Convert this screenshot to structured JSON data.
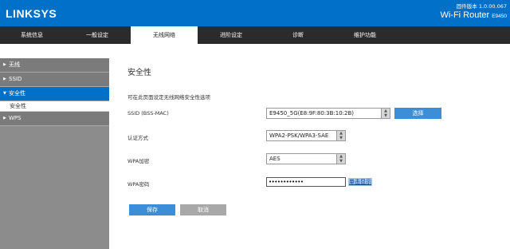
{
  "header": {
    "logo": "LINKSYS",
    "firmware_label": "固件版本 1.0.00.067",
    "product": "Wi-Fi Router",
    "model": "E9450"
  },
  "tabs": [
    {
      "label": "系统信息",
      "active": false
    },
    {
      "label": "一般设定",
      "active": false
    },
    {
      "label": "无线网络",
      "active": true
    },
    {
      "label": "进阶设定",
      "active": false
    },
    {
      "label": "诊断",
      "active": false
    },
    {
      "label": "维护功能",
      "active": false
    }
  ],
  "sidebar": {
    "items": [
      {
        "label": "无线",
        "arrow": "▶"
      },
      {
        "label": "SSID",
        "arrow": "▶"
      },
      {
        "label": "安全性",
        "arrow": "▼",
        "active": true
      },
      {
        "label": "安全性",
        "sub": true
      },
      {
        "label": "WPS",
        "arrow": "▶"
      }
    ]
  },
  "main": {
    "title": "安全性",
    "description": "可在此页面设定无线网络安全性选项",
    "ssid_label": "SSID (BSS-MAC)",
    "ssid_value": "E9450_5G(E8:9F:80:3B:10:2B)",
    "choose_button": "选择",
    "auth_label": "认证方式",
    "auth_value": "WPA2-PSK/WPA3-SAE",
    "encryption_label": "WPA加密",
    "encryption_value": "AES",
    "password_label": "WPA密码",
    "password_value": "••••••••••••",
    "show_link": "单击显示",
    "save_button": "保存",
    "cancel_button": "取消"
  },
  "colors": {
    "brand_blue": "#0070c9",
    "tab_bar": "#2b2b2b",
    "button_blue": "#3d8ed9",
    "sidebar_gray": "#8c8c8c"
  }
}
